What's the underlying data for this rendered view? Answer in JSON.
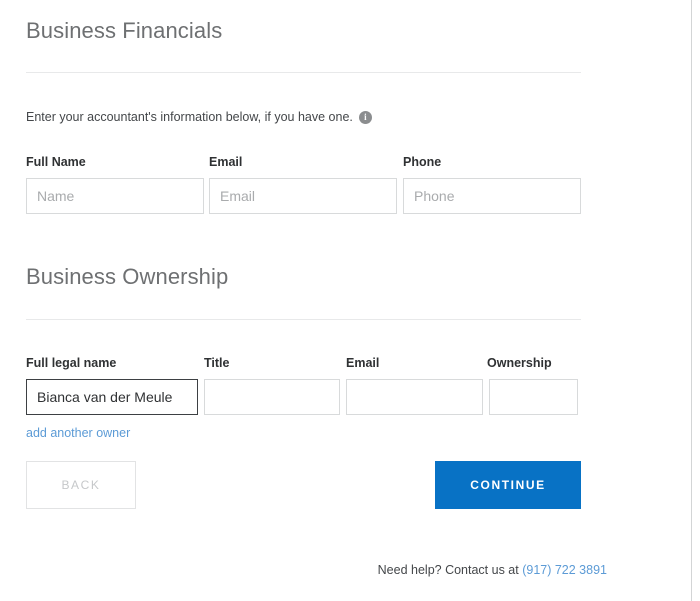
{
  "financials": {
    "heading": "Business Financials",
    "helper_text": "Enter your accountant's information below, if you have one.",
    "info_icon_glyph": "i",
    "fields": [
      {
        "label": "Full Name",
        "placeholder": "Name",
        "value": ""
      },
      {
        "label": "Email",
        "placeholder": "Email",
        "value": ""
      },
      {
        "label": "Phone",
        "placeholder": "Phone",
        "value": ""
      }
    ]
  },
  "ownership": {
    "heading": "Business Ownership",
    "fields": [
      {
        "label": "Full legal name",
        "placeholder": "",
        "value": "Bianca van der Meule"
      },
      {
        "label": "Title",
        "placeholder": "",
        "value": ""
      },
      {
        "label": "Email",
        "placeholder": "",
        "value": ""
      },
      {
        "label": "Ownership",
        "placeholder": "",
        "value": ""
      }
    ],
    "add_owner_label": "add another owner"
  },
  "actions": {
    "back_label": "BACK",
    "continue_label": "CONTINUE"
  },
  "footer": {
    "help_text": "Need help? Contact us at ",
    "phone": "(917) 722 3891"
  },
  "colors": {
    "accent_blue": "#0872c5",
    "link_blue": "#5c9bd6",
    "heading_gray": "#6e7072",
    "border_gray": "#d8dadb",
    "divider_gray": "#e8e9ea"
  }
}
